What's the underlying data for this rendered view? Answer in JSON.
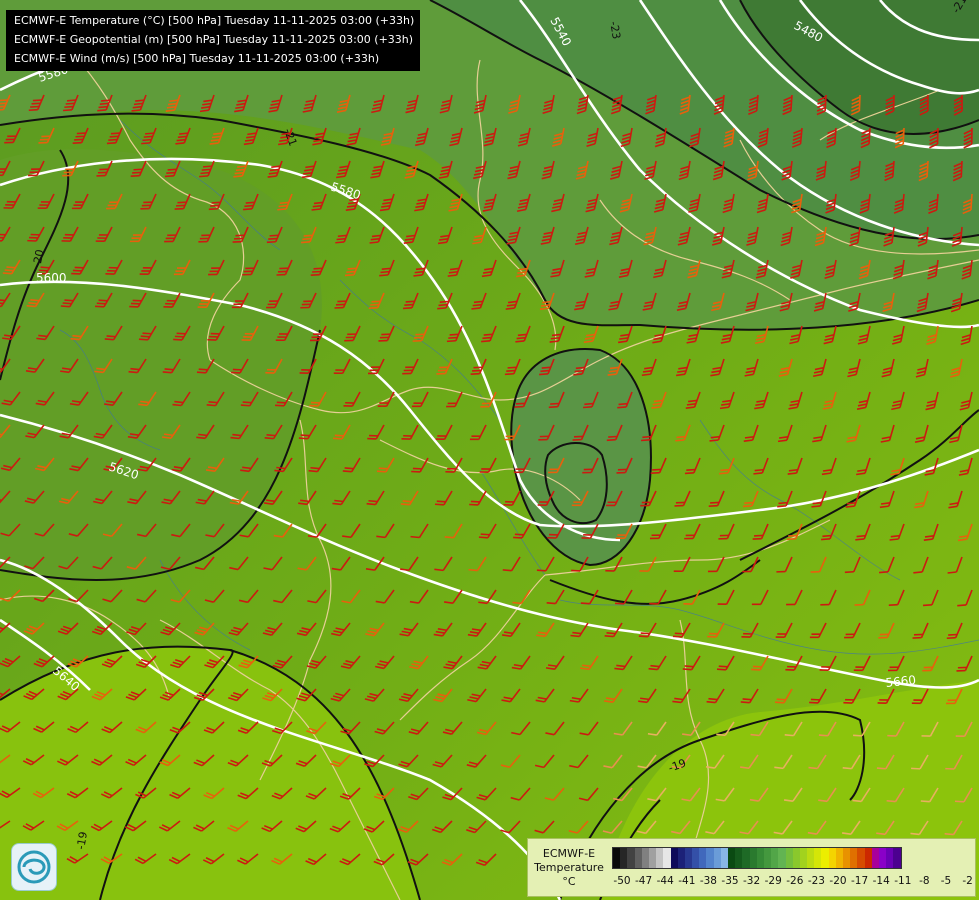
{
  "header": {
    "line1": "ECMWF-E Temperature (°C) [500 hPa] Tuesday 11-11-2025 03:00 (+33h)",
    "line2": "ECMWF-E Geopotential (m) [500 hPa] Tuesday 11-11-2025 03:00 (+33h)",
    "line3": "ECMWF-E Wind (m/s) [500 hPa] Tuesday 11-11-2025 03:00 (+33h)"
  },
  "geopotential_labels": [
    "5480",
    "5540",
    "5580",
    "5600",
    "5620",
    "5640",
    "5660"
  ],
  "temperature_labels": [
    "-23",
    "-21",
    "-20",
    "-19"
  ],
  "legend": {
    "model": "ECMWF-E",
    "variable": "Temperature",
    "unit": "°C",
    "ticks": [
      "-50",
      "-47",
      "-44",
      "-41",
      "-38",
      "-35",
      "-32",
      "-29",
      "-26",
      "-23",
      "-20",
      "-17",
      "-14",
      "-11",
      "-8",
      "-5",
      "-2"
    ],
    "colors": [
      "#0a0a0a",
      "#262626",
      "#424242",
      "#606060",
      "#808080",
      "#a0a0a0",
      "#c4c4c4",
      "#e6e6e6",
      "#0e0a5a",
      "#1c2178",
      "#283890",
      "#3450a8",
      "#4068bc",
      "#5283cc",
      "#6a9cd8",
      "#88b6e6",
      "#0a4a12",
      "#145a1c",
      "#1e6a26",
      "#2a7a2e",
      "#368a36",
      "#44983e",
      "#52a648",
      "#62b452",
      "#74be3c",
      "#8ac82c",
      "#a2d21e",
      "#bcdc12",
      "#d4e608",
      "#ecee00",
      "#f4d400",
      "#f0b400",
      "#e89200",
      "#e07000",
      "#d64c00",
      "#cc2800",
      "#a8009a",
      "#8a00c8",
      "#6a00b4",
      "#4c0090"
    ]
  }
}
